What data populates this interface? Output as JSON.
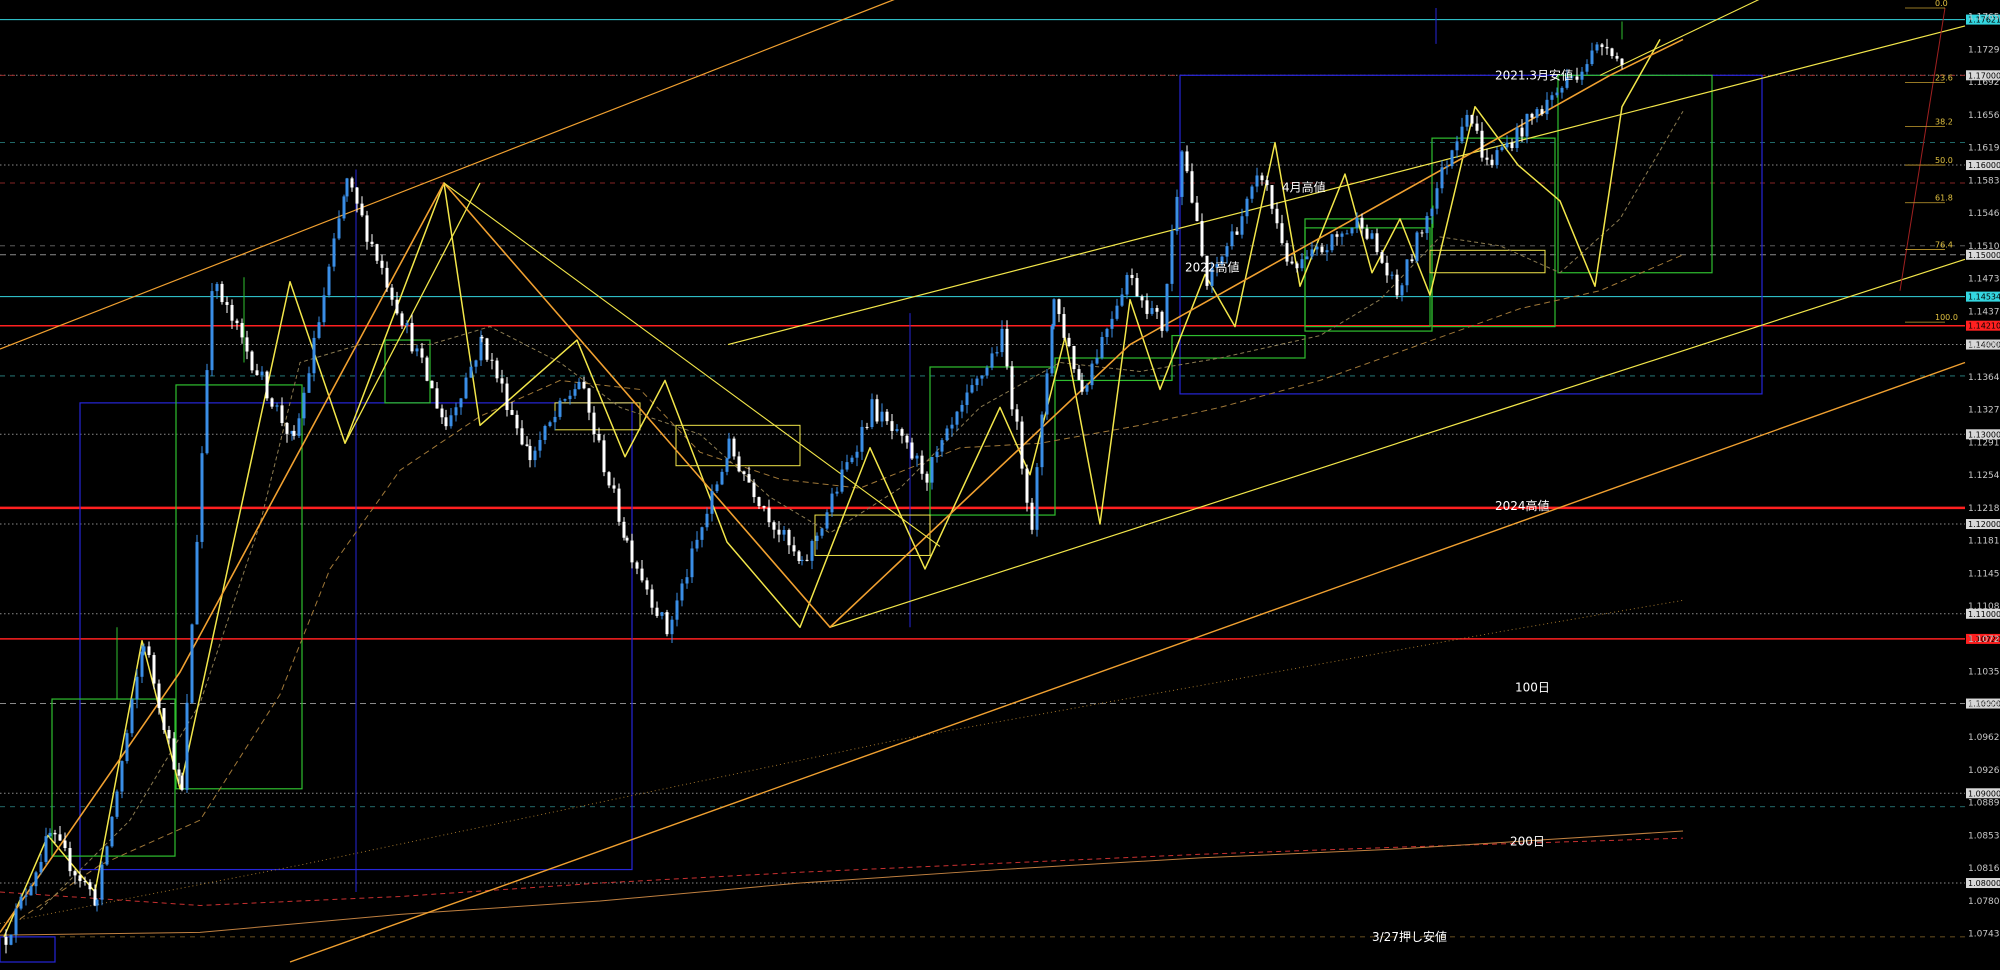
{
  "chart_data": {
    "type": "candlestick",
    "ylim": [
      1.0712,
      1.1775
    ],
    "grid": false,
    "colors": {
      "background": "#000000",
      "candle_up": "#3a8ee6",
      "candle_down": "#ffffff",
      "trend_yellow": "#f2e64a",
      "trend_orange": "#f0a030",
      "box_green": "#2fbf2f",
      "box_blue": "#2626d9",
      "level_red": "#ff2020",
      "level_cyan": "#34d6e0"
    },
    "price_axis_labels": [
      "1.17655",
      "1.17290",
      "1.16925",
      "1.16560",
      "1.16195",
      "1.15830",
      "1.15465",
      "1.15100",
      "1.14735",
      "1.14370",
      "1.14005",
      "1.13640",
      "1.13275",
      "1.12910",
      "1.12545",
      "1.12180",
      "1.11815",
      "1.11450",
      "1.11085",
      "1.10720",
      "1.10355",
      "1.09990",
      "1.09625",
      "1.09260",
      "1.08895",
      "1.08530",
      "1.08165",
      "1.07800",
      "1.07435"
    ],
    "highlighted_prices": [
      {
        "label": "1.17000",
        "kind": "dotted"
      },
      {
        "label": "1.16000",
        "kind": "dotted"
      },
      {
        "label": "1.15000",
        "kind": "dashed"
      },
      {
        "label": "1.14000",
        "kind": "dotted"
      },
      {
        "label": "1.13000",
        "kind": "dotted"
      },
      {
        "label": "1.12000",
        "kind": "dotted"
      },
      {
        "label": "1.11000",
        "kind": "dotted"
      },
      {
        "label": "1.10000",
        "kind": "dashed"
      },
      {
        "label": "1.09000",
        "kind": "dotted"
      },
      {
        "label": "1.08000",
        "kind": "dotted"
      }
    ],
    "price_tags": [
      {
        "label": "1.17621",
        "color": "#34d6e0"
      },
      {
        "label": "1.14534",
        "color": "#34d6e0"
      },
      {
        "label": "1.14210",
        "color": "#ff2020"
      },
      {
        "label": "1.10720",
        "color": "#ff2020"
      }
    ],
    "annotations": [
      {
        "text": "2021.3月安値",
        "price": 1.17
      },
      {
        "text": "4月高値",
        "price": 1.1575
      },
      {
        "text": "2022高値",
        "price": 1.1486
      },
      {
        "text": "2024高値",
        "price": 1.122
      },
      {
        "text": "100日",
        "price": 1.1018
      },
      {
        "text": "200日",
        "price": 1.0846
      },
      {
        "text": "3/27押し安値",
        "price": 1.074
      }
    ],
    "fib_labels": [
      "0.0",
      "23.6",
      "38.2",
      "50.0",
      "61.8",
      "76.4",
      "100.0"
    ],
    "pivots": [
      1.074,
      1.0853,
      1.078,
      1.107,
      1.09,
      1.147,
      1.129,
      1.158,
      1.131,
      1.1405,
      1.1275,
      1.136,
      1.118,
      1.108,
      1.1285,
      1.115,
      1.133,
      1.1255,
      1.1408,
      1.12,
      1.145,
      1.135,
      1.1478,
      1.142,
      1.1625,
      1.1465,
      1.159,
      1.148,
      1.154,
      1.1455,
      1.1665,
      1.16,
      1.174,
      1.1705
    ]
  }
}
